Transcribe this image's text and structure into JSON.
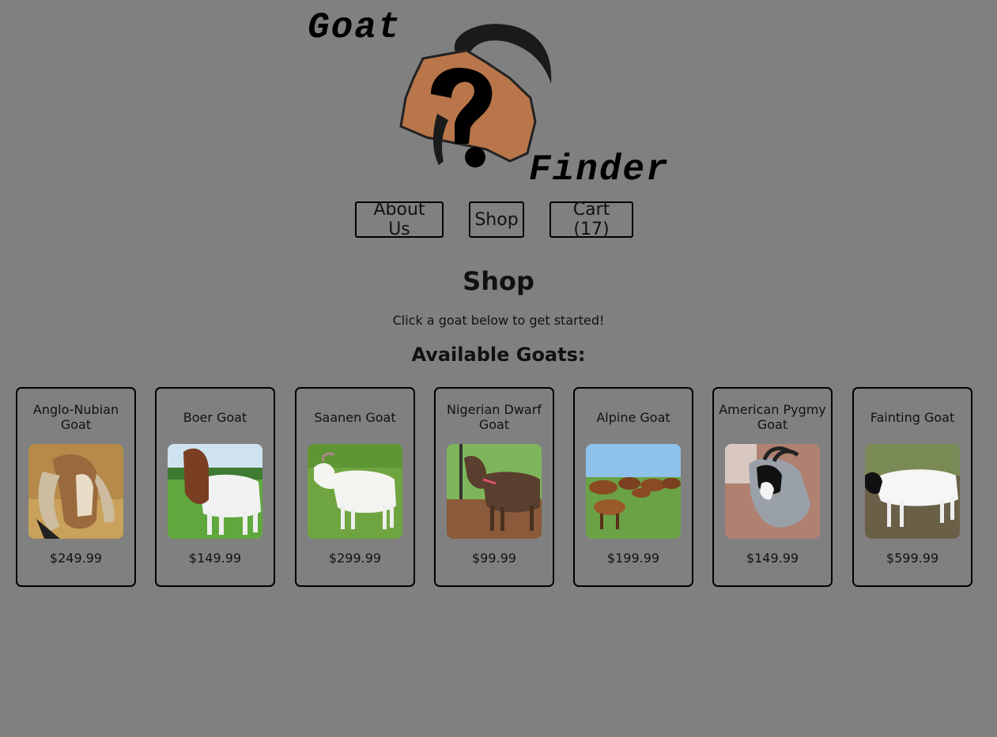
{
  "logo": {
    "word_top": "Goat",
    "word_bottom": "Finder",
    "icon": "goat-question-icon",
    "colors": {
      "head": "#b8764a",
      "horn": "#1a1a1a",
      "mark": "#000000"
    }
  },
  "nav": {
    "about_label": "About Us",
    "shop_label": "Shop",
    "cart_label": "Cart (17)"
  },
  "page": {
    "title": "Shop",
    "intro": "Click a goat below to get started!",
    "section_title": "Available Goats:"
  },
  "goats": [
    {
      "name": "Anglo-Nubian Goat",
      "price": "$249.99",
      "photo": "anglo-nubian-goat-photo"
    },
    {
      "name": "Boer Goat",
      "price": "$149.99",
      "photo": "boer-goat-photo"
    },
    {
      "name": "Saanen Goat",
      "price": "$299.99",
      "photo": "saanen-goat-photo"
    },
    {
      "name": "Nigerian Dwarf Goat",
      "price": "$99.99",
      "photo": "nigerian-dwarf-goat-photo"
    },
    {
      "name": "Alpine Goat",
      "price": "$199.99",
      "photo": "alpine-goat-photo"
    },
    {
      "name": "American Pygmy Goat",
      "price": "$149.99",
      "photo": "american-pygmy-goat-photo"
    },
    {
      "name": "Fainting Goat",
      "price": "$599.99",
      "photo": "fainting-goat-photo"
    }
  ],
  "colors": {
    "background": "#808080",
    "border": "#000000",
    "text": "#111111"
  }
}
